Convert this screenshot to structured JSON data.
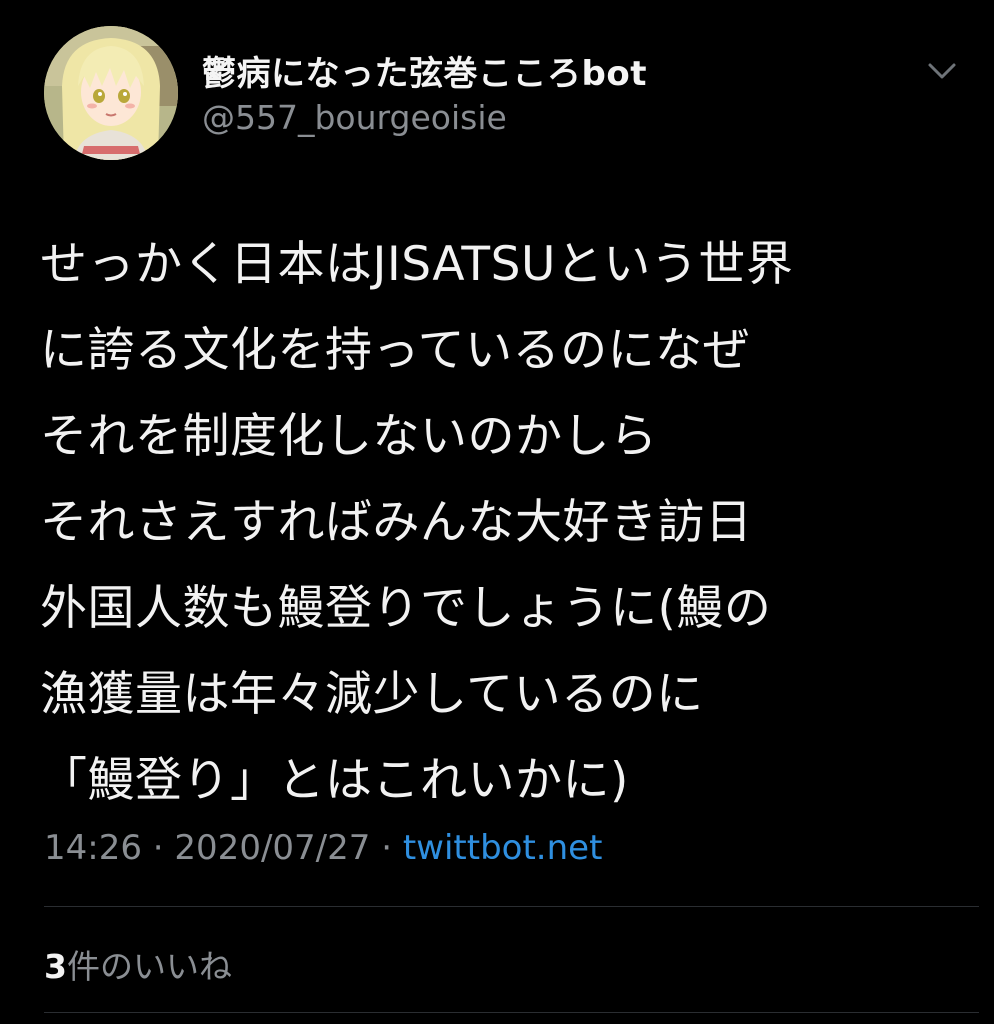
{
  "user": {
    "display_name": "鬱病になった弦巻こころbot",
    "handle": "@557_bourgeoisie",
    "avatar_icon": "avatar-image"
  },
  "menu_icon": "chevron-down-icon",
  "tweet": {
    "lines": [
      "せっかく日本はJISATSUという世界",
      "に誇る文化を持っているのになぜ",
      "それを制度化しないのかしら",
      "それさえすればみんな大好き訪日",
      "外国人数も鰻登りでしょうに(鰻の",
      "漁獲量は年々減少しているのに",
      "「鰻登り」とはこれいかに)"
    ]
  },
  "meta": {
    "time": "14:26",
    "separator": "·",
    "date": "2020/07/27",
    "source": "twittbot.net"
  },
  "likes": {
    "count": "3",
    "label": "件のいいね"
  },
  "colors": {
    "background": "#000000",
    "text": "#f2f2f2",
    "muted": "#8a8e93",
    "link": "#2f8fe0",
    "divider": "#2a2d31"
  }
}
